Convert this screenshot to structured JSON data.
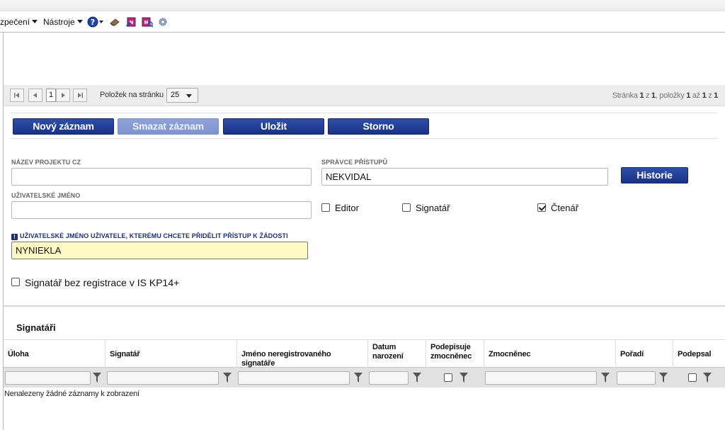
{
  "menu": {
    "security_label": "zpečení",
    "tools_label": "Nástroje"
  },
  "pager": {
    "current_page": "1",
    "per_page_label": "Položek na stránku",
    "per_page_value": "25",
    "info_prefix": "Stránka",
    "info_page": "1",
    "info_of": "z",
    "info_total_pages": "1",
    "info_items_label": ", položky",
    "info_from": "1",
    "info_to_label": "až",
    "info_to": "1",
    "info_of2": "z",
    "info_total_items": "1"
  },
  "toolbar": {
    "new_label": "Nový záznam",
    "delete_label": "Smazat záznam",
    "save_label": "Uložit",
    "cancel_label": "Storno"
  },
  "form": {
    "project_name_label": "NÁZEV PROJEKTU CZ",
    "project_name_value": "",
    "access_admin_label": "SPRÁVCE PŘÍSTUPŮ",
    "access_admin_value": "NEKVIDAL",
    "history_label": "Historie",
    "username_label": "UŽIVATELSKÉ JMÉNO",
    "username_value": "",
    "editor_label": "Editor",
    "editor_checked": false,
    "signatory_label": "Signatář",
    "signatory_checked": false,
    "reader_label": "Čtenář",
    "reader_checked": true,
    "grant_user_label": "UŽIVATELSKÉ JMÉNO UŽIVATELE, KTERÉMU CHCETE PŘIDĚLIT PŘÍSTUP K ŽÁDOSTI",
    "grant_user_value": "NYNIEKLA",
    "unregistered_label": "Signatář bez registrace v IS KP14+",
    "unregistered_checked": false
  },
  "signatories": {
    "title": "Signatáři",
    "columns": [
      {
        "line1": "Úloha",
        "line2": ""
      },
      {
        "line1": "Signatář",
        "line2": ""
      },
      {
        "line1": "Jméno neregistrovaného signatáře",
        "line2": ""
      },
      {
        "line1": "Datum",
        "line2": "narození"
      },
      {
        "line1": "Podepisuje",
        "line2": "zmocněnec"
      },
      {
        "line1": "Zmocněnec",
        "line2": ""
      },
      {
        "line1": "Pořadí",
        "line2": ""
      },
      {
        "line1": "Podepsal",
        "line2": ""
      }
    ],
    "empty_message": "Nenalezeny žádné záznamy k zobrazení"
  },
  "colors": {
    "primary_button": "#1f3a8f",
    "disabled_button": "#8a9ed6",
    "required_highlight": "#fff9c4",
    "label_grey": "#666666"
  }
}
